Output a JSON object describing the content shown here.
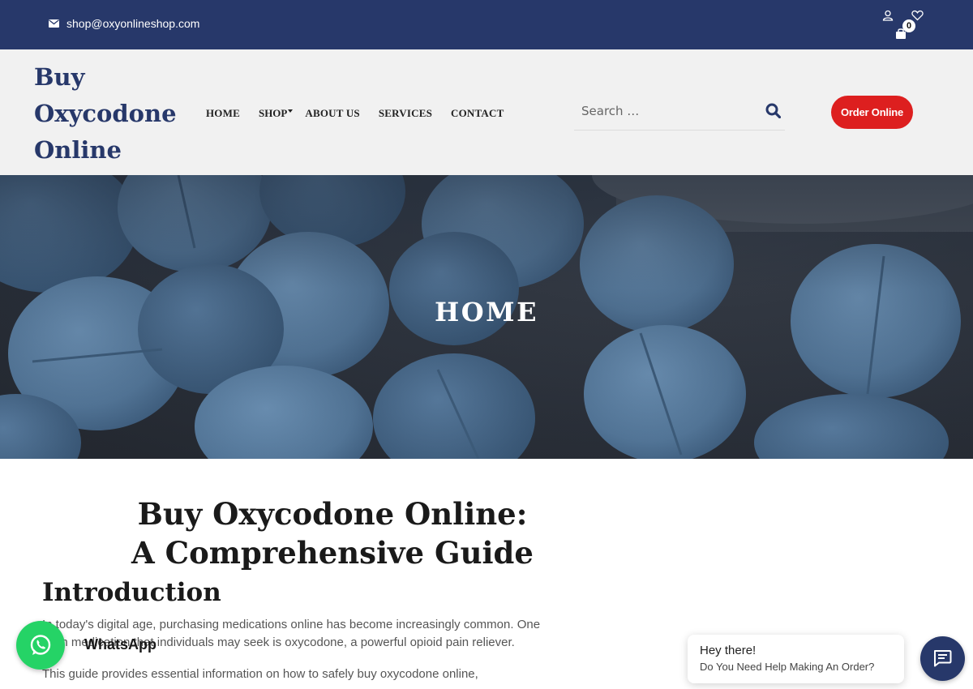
{
  "topbar": {
    "email": "shop@oxyonlineshop.com",
    "cart_count": "0"
  },
  "header": {
    "logo_line1": "Buy",
    "logo_line2": "Oxycodone",
    "logo_line3": "Online",
    "nav": {
      "home": "HOME",
      "shop": "SHOP",
      "about": "ABOUT US",
      "services": "SERVICES",
      "contact": "CONTACT"
    },
    "search_placeholder": "Search …",
    "order_button": "Order Online"
  },
  "hero": {
    "title": "HOME"
  },
  "content": {
    "title_line1": "Buy Oxycodone Online:",
    "title_line2": "A Comprehensive Guide",
    "intro_heading": "Introduction",
    "para1": "In today's digital age, purchasing medications online has become increasingly common. One such medication that individuals may seek is oxycodone, a powerful opioid pain reliever.",
    "para2": "This guide provides essential information on how to safely buy oxycodone online,"
  },
  "whatsapp": {
    "label": "WhatsApp"
  },
  "chat": {
    "greeting": "Hey there!",
    "message": "Do You Need Help Making An Order?"
  },
  "colors": {
    "brand_navy": "#27386a",
    "order_red": "#dd1f1f",
    "whatsapp_green": "#25d366"
  },
  "icons": [
    "envelope-icon",
    "user-icon",
    "heart-icon",
    "shopping-bag-icon",
    "search-icon",
    "whatsapp-icon",
    "chat-icon"
  ]
}
